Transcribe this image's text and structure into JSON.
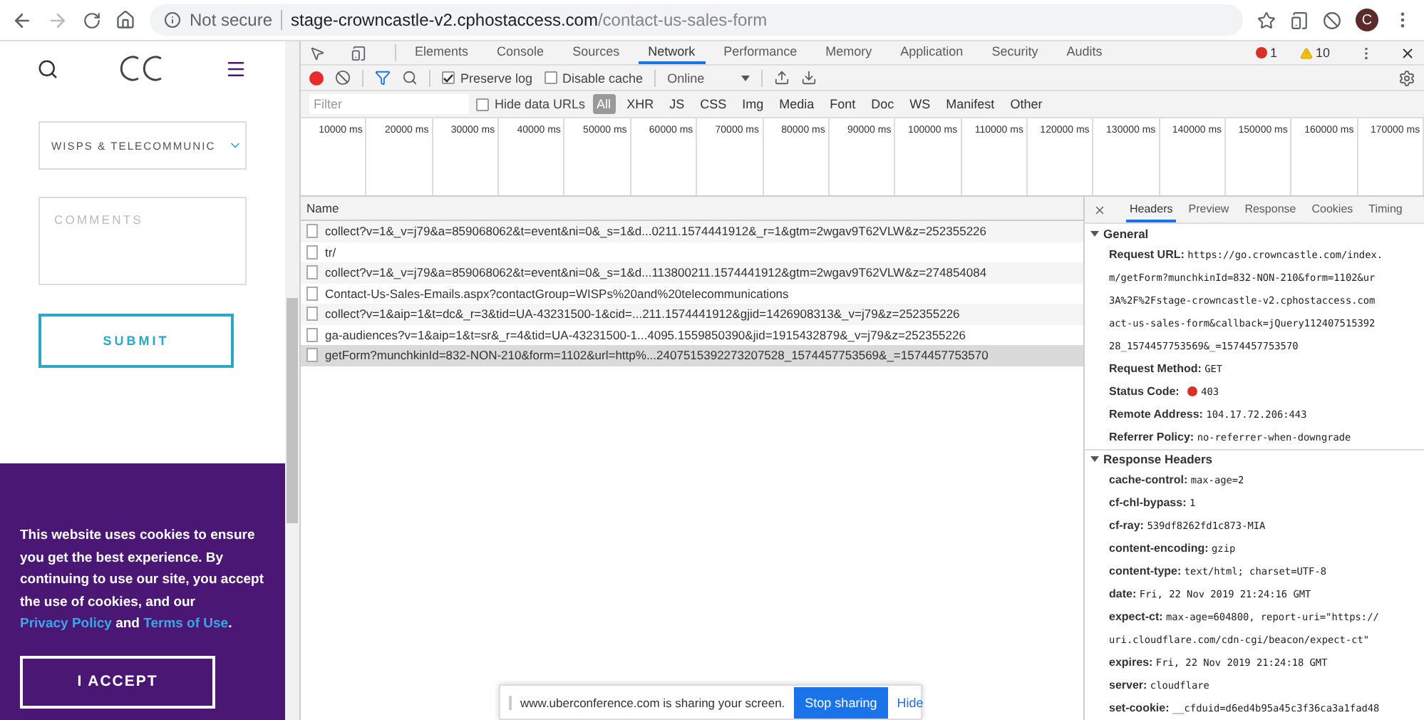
{
  "browser": {
    "security_label": "Not secure",
    "url_host": "stage-crowncastle-v2.cphostaccess.com",
    "url_path": "/contact-us-sales-form",
    "avatar": "C"
  },
  "page": {
    "select_value": "WISPS & TELECOMMUNIC",
    "comments_placeholder": "COMMENTS",
    "submit": "SUBMIT",
    "cookie_banner": {
      "text": "This website uses cookies to ensure you get the best experience. By continuing to use our site, you accept the use of cookies, and our ",
      "privacy_link": "Privacy Policy",
      "joiner": " and ",
      "terms_link": "Terms of Use",
      "end": ".",
      "accept": "I ACCEPT"
    }
  },
  "devtools": {
    "tabs": [
      {
        "label": "Elements",
        "selected": false
      },
      {
        "label": "Console",
        "selected": false
      },
      {
        "label": "Sources",
        "selected": false
      },
      {
        "label": "Network",
        "selected": true
      },
      {
        "label": "Performance",
        "selected": false
      },
      {
        "label": "Memory",
        "selected": false
      },
      {
        "label": "Application",
        "selected": false
      },
      {
        "label": "Security",
        "selected": false
      },
      {
        "label": "Audits",
        "selected": false
      }
    ],
    "errors": "1",
    "warnings": "10",
    "toolbar": {
      "preserve_log": {
        "label": "Preserve log",
        "checked": true
      },
      "disable_cache": {
        "label": "Disable cache",
        "checked": false
      },
      "throttling": "Online"
    },
    "filter": {
      "placeholder": "Filter",
      "hide_data_urls": {
        "label": "Hide data URLs",
        "checked": false
      },
      "types": [
        {
          "label": "All",
          "selected": true
        },
        {
          "label": "XHR",
          "selected": false
        },
        {
          "label": "JS",
          "selected": false
        },
        {
          "label": "CSS",
          "selected": false
        },
        {
          "label": "Img",
          "selected": false
        },
        {
          "label": "Media",
          "selected": false
        },
        {
          "label": "Font",
          "selected": false
        },
        {
          "label": "Doc",
          "selected": false
        },
        {
          "label": "WS",
          "selected": false
        },
        {
          "label": "Manifest",
          "selected": false
        },
        {
          "label": "Other",
          "selected": false
        }
      ]
    },
    "timeline_ticks": [
      "10000 ms",
      "20000 ms",
      "30000 ms",
      "40000 ms",
      "50000 ms",
      "60000 ms",
      "70000 ms",
      "80000 ms",
      "90000 ms",
      "100000 ms",
      "110000 ms",
      "120000 ms",
      "130000 ms",
      "140000 ms",
      "150000 ms",
      "160000 ms",
      "170000 ms"
    ],
    "requests": {
      "column": "Name",
      "rows": [
        {
          "name": "collect?v=1&_v=j79&a=859068062&t=event&ni=0&_s=1&d...0211.1574441912&_r=1&gtm=2wgav9T62VLW&z=252355226",
          "selected": false
        },
        {
          "name": "tr/",
          "selected": false
        },
        {
          "name": "collect?v=1&_v=j79&a=859068062&t=event&ni=0&_s=1&d...113800211.1574441912&gtm=2wgav9T62VLW&z=274854084",
          "selected": false
        },
        {
          "name": "Contact-Us-Sales-Emails.aspx?contactGroup=WISPs%20and%20telecommunications",
          "selected": false
        },
        {
          "name": "collect?v=1&aip=1&t=dc&_r=3&tid=UA-43231500-1&cid=...211.1574441912&gjid=1426908313&_v=j79&z=252355226",
          "selected": false
        },
        {
          "name": "ga-audiences?v=1&aip=1&t=sr&_r=4&tid=UA-43231500-1...4095.1559850390&jid=1915432879&_v=j79&z=252355226",
          "selected": false
        },
        {
          "name": "getForm?munchkinId=832-NON-210&form=1102&url=http%...2407515392273207528_1574457753569&_=1574457753570",
          "selected": true
        }
      ]
    },
    "details": {
      "tabs": [
        {
          "label": "Headers",
          "selected": true
        },
        {
          "label": "Preview",
          "selected": false
        },
        {
          "label": "Response",
          "selected": false
        },
        {
          "label": "Cookies",
          "selected": false
        },
        {
          "label": "Timing",
          "selected": false
        }
      ],
      "sections": [
        {
          "title": "General",
          "expanded": true,
          "items": [
            {
              "key": "Request URL:",
              "lines": [
                "https://go.crowncastle.com/index.",
                "m/getForm?munchkinId=832-NON-210&form=1102&ur",
                "3A%2F%2Fstage-crowncastle-v2.cphostaccess.com",
                "act-us-sales-form&callback=jQuery112407515392",
                "28_1574457753569&_=1574457753570"
              ]
            },
            {
              "key": "Request Method:",
              "lines": [
                "GET"
              ]
            },
            {
              "key": "Status Code:",
              "lines": [
                "403"
              ],
              "kind": "status"
            },
            {
              "key": "Remote Address:",
              "lines": [
                "104.17.72.206:443"
              ]
            },
            {
              "key": "Referrer Policy:",
              "lines": [
                "no-referrer-when-downgrade"
              ]
            }
          ]
        },
        {
          "title": "Response Headers",
          "expanded": true,
          "items": [
            {
              "key": "cache-control:",
              "lines": [
                "max-age=2"
              ]
            },
            {
              "key": "cf-chl-bypass:",
              "lines": [
                "1"
              ]
            },
            {
              "key": "cf-ray:",
              "lines": [
                "539df8262fd1c873-MIA"
              ]
            },
            {
              "key": "content-encoding:",
              "lines": [
                "gzip"
              ]
            },
            {
              "key": "content-type:",
              "lines": [
                "text/html; charset=UTF-8"
              ]
            },
            {
              "key": "date:",
              "lines": [
                "Fri, 22 Nov 2019 21:24:16 GMT"
              ]
            },
            {
              "key": "expect-ct:",
              "lines": [
                "max-age=604800, report-uri=\"https://",
                "uri.cloudflare.com/cdn-cgi/beacon/expect-ct\""
              ]
            },
            {
              "key": "expires:",
              "lines": [
                "Fri, 22 Nov 2019 21:24:18 GMT"
              ]
            },
            {
              "key": "server:",
              "lines": [
                "cloudflare"
              ]
            },
            {
              "key": "set-cookie:",
              "lines": [
                "__cfduid=d6ed4b95a45c3f36ca3a1fad48"
              ]
            }
          ]
        }
      ]
    }
  },
  "share_bar": {
    "message": "www.uberconference.com is sharing your screen.",
    "stop": "Stop sharing",
    "hide": "Hide"
  }
}
